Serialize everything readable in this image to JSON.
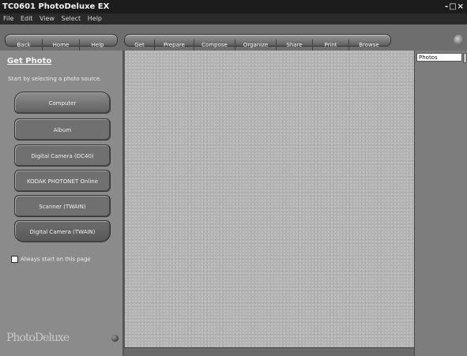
{
  "window": {
    "title": "TC0601 PhotoDeluxe EX",
    "controls": "-□×"
  },
  "menu": [
    "File",
    "Edit",
    "View",
    "Select",
    "Help"
  ],
  "toolbar": {
    "nav": [
      "Back",
      "Home",
      "Help"
    ],
    "steps": [
      "Get",
      "Prepare",
      "Compose",
      "Organize",
      "Share",
      "Print",
      "Browse"
    ]
  },
  "left_panel": {
    "title": "Get Photo",
    "subtitle": "Start by selecting a photo source.",
    "sources": [
      "Computer",
      "Album",
      "Digital Camera (DC40)",
      "KODAK PHOTONET Online",
      "Scanner (TWAIN)",
      "Digital Camera (TWAIN)"
    ],
    "checkbox_label": "Always start on this page",
    "checkbox_checked": false,
    "logo_text": "PhotoDeluxe"
  },
  "right_panel": {
    "header": "Photos"
  }
}
